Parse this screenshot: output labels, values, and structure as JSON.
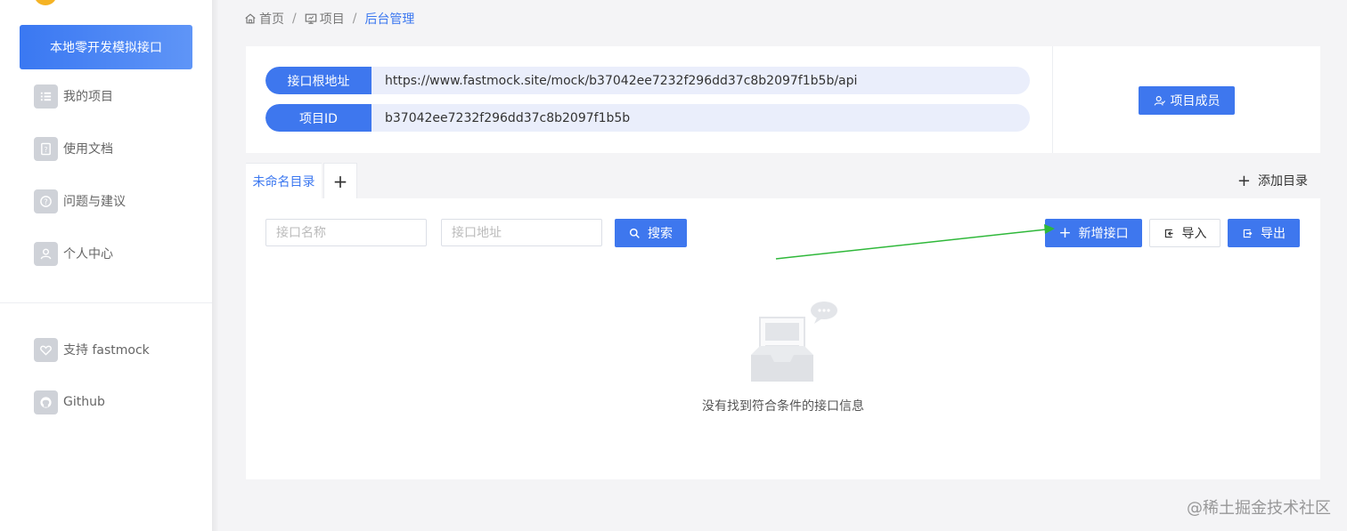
{
  "sidebar": {
    "active_label": "本地零开发模拟接口",
    "items": [
      {
        "label": "我的项目",
        "icon": "list-icon"
      },
      {
        "label": "使用文档",
        "icon": "document-icon"
      },
      {
        "label": "问题与建议",
        "icon": "question-icon"
      },
      {
        "label": "个人中心",
        "icon": "user-icon"
      }
    ],
    "extras": [
      {
        "label": "支持 fastmock",
        "icon": "heart-icon"
      },
      {
        "label": "Github",
        "icon": "github-icon"
      }
    ]
  },
  "breadcrumb": {
    "home": "首页",
    "project": "项目",
    "current": "后台管理"
  },
  "info": {
    "root_label": "接口根地址",
    "root_value": "https://www.fastmock.site/mock/b37042ee7232f296dd37c8b2097f1b5b/api",
    "id_label": "项目ID",
    "id_value": "b37042ee7232f296dd37c8b2097f1b5b",
    "members_button": "项目成员"
  },
  "tabs": {
    "active": "未命名目录",
    "add_tab_symbol": "+",
    "add_directory": "添加目录"
  },
  "toolbar": {
    "name_placeholder": "接口名称",
    "url_placeholder": "接口地址",
    "search_label": "搜索",
    "new_label": "新增接口",
    "import_label": "导入",
    "export_label": "导出"
  },
  "empty": {
    "message": "没有找到符合条件的接口信息"
  },
  "watermark": "@稀土掘金技术社区",
  "colors": {
    "accent": "#3e77ee",
    "annotation_arrow": "#2fb83a"
  }
}
